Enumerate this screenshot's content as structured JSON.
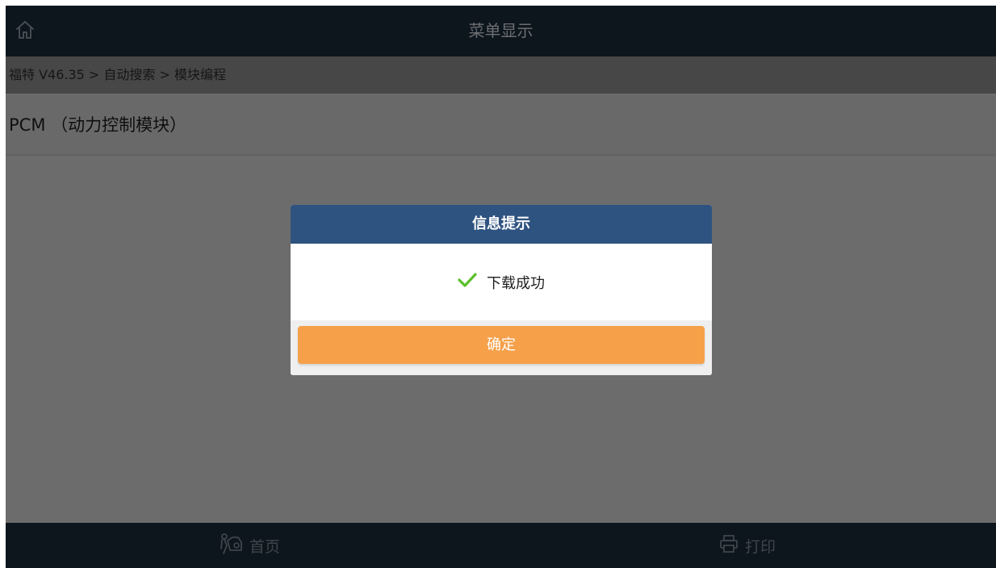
{
  "header": {
    "title": "菜单显示",
    "home_icon": "home-icon"
  },
  "breadcrumb": "福特 V46.35 > 自动搜索 > 模块编程",
  "menu": {
    "items": [
      {
        "label": "PCM （动力控制模块）"
      }
    ]
  },
  "dialog": {
    "title": "信息提示",
    "message": "下载成功",
    "status_icon": "check-icon",
    "confirm_label": "确定"
  },
  "footer": {
    "home_label": "首页",
    "home_icon": "diagnose-home-icon",
    "print_label": "打印",
    "print_icon": "printer-icon"
  },
  "colors": {
    "bar_bg": "#1a2a3b",
    "dialog_header": "#2f5380",
    "confirm_button": "#f6a04a",
    "success_check": "#5cbf2a"
  }
}
